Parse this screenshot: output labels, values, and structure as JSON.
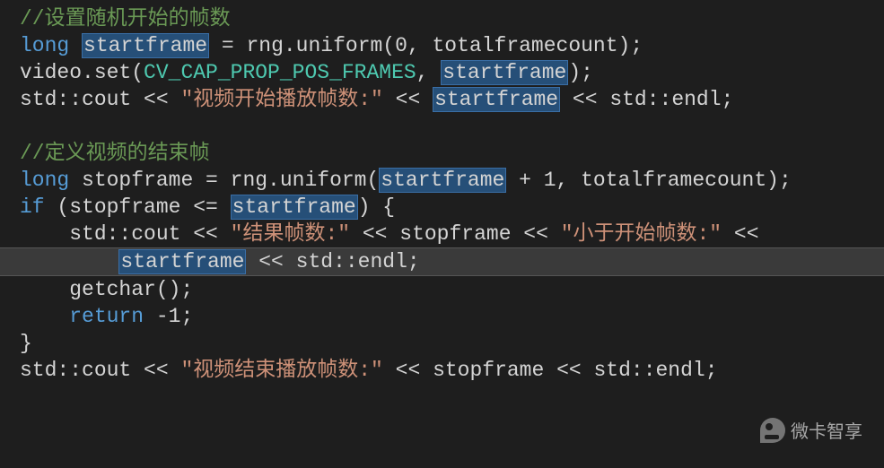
{
  "code": {
    "line1": "//设置随机开始的帧数",
    "line2_p1": "long",
    "line2_p2": "startframe",
    "line2_p3": " = rng.uniform(0, totalframecount);",
    "line3_p1": "video.set(",
    "line3_p2": "CV_CAP_PROP_POS_FRAMES",
    "line3_p3": ", ",
    "line3_p4": "startframe",
    "line3_p5": ");",
    "line4_p1": "std::cout << ",
    "line4_p2": "\"视频开始播放帧数:\"",
    "line4_p3": " << ",
    "line4_p4": "startframe",
    "line4_p5": " << std::endl;",
    "line6": "//定义视频的结束帧",
    "line7_p1": "long",
    "line7_p2": " stopframe = rng.uniform(",
    "line7_p3": "startframe",
    "line7_p4": " + 1, totalframecount);",
    "line8_p1": "if",
    "line8_p2": " (stopframe <= ",
    "line8_p3": "startframe",
    "line8_p4": ") {",
    "line9_p1": "    std::cout << ",
    "line9_p2": "\"结果帧数:\"",
    "line9_p3": " << stopframe << ",
    "line9_p4": "\"小于开始帧数:\"",
    "line9_p5": " <<",
    "line10_p1": "        ",
    "line10_p2": "startframe",
    "line10_p3": " << std::endl;",
    "line11": "    getchar();",
    "line12_p1": "    ",
    "line12_p2": "return",
    "line12_p3": " -1;",
    "line13": "}",
    "line14_p1": "std::cout << ",
    "line14_p2": "\"视频结束播放帧数:\"",
    "line14_p3": " << stopframe << std::endl;"
  },
  "watermark": {
    "text": "微卡智享"
  }
}
